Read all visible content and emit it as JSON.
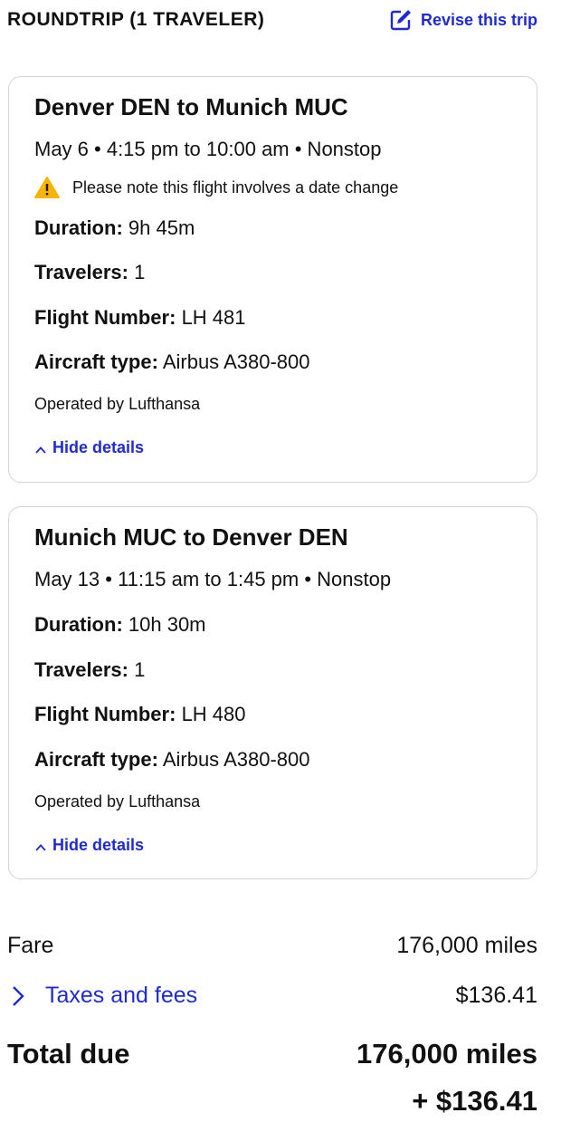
{
  "header": {
    "title": "ROUNDTRIP (1 TRAVELER)",
    "revise_label": "Revise this trip"
  },
  "flights": [
    {
      "route": "Denver DEN to Munich MUC",
      "times": "May 6 • 4:15 pm to 10:00 am • Nonstop",
      "warning": "Please note this flight involves a date change",
      "duration_label": "Duration:",
      "duration": "9h 45m",
      "travelers_label": "Travelers:",
      "travelers": "1",
      "flight_number_label": "Flight Number:",
      "flight_number": "LH 481",
      "aircraft_label": "Aircraft type:",
      "aircraft": "Airbus A380-800",
      "operated_by": "Operated by Lufthansa",
      "toggle_label": "Hide details"
    },
    {
      "route": "Munich MUC to Denver DEN",
      "times": "May 13 • 11:15 am to 1:45 pm • Nonstop",
      "duration_label": "Duration:",
      "duration": "10h 30m",
      "travelers_label": "Travelers:",
      "travelers": "1",
      "flight_number_label": "Flight Number:",
      "flight_number": "LH 480",
      "aircraft_label": "Aircraft type:",
      "aircraft": "Airbus A380-800",
      "operated_by": "Operated by Lufthansa",
      "toggle_label": "Hide details"
    }
  ],
  "summary": {
    "fare_label": "Fare",
    "fare_value": "176,000 miles",
    "taxes_label": "Taxes and fees",
    "taxes_value": "$136.41",
    "total_label": "Total due",
    "total_miles": "176,000 miles",
    "total_cash": "+ $136.41"
  },
  "colors": {
    "link": "#1f2bd1",
    "warning": "#f5b400",
    "card_border": "#d4d4d8"
  },
  "icons": {
    "revise": "edit-icon",
    "warning": "warning-icon",
    "toggle": "chevron-up-icon",
    "taxes": "chevron-right-icon"
  }
}
